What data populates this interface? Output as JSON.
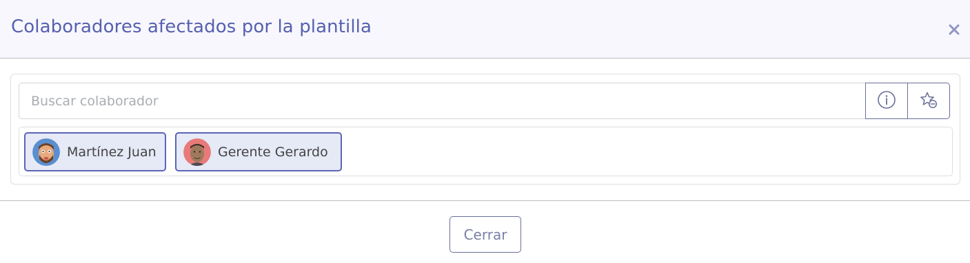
{
  "modal": {
    "title": "Colaboradores afectados por la plantilla",
    "close_icon": "close-icon"
  },
  "search": {
    "placeholder": "Buscar colaborador",
    "value": "",
    "info_icon": "info-icon",
    "favorite_icon": "star-minus-icon"
  },
  "collaborators": [
    {
      "name": "Martínez Juan",
      "avatar": "cartoon-avatar"
    },
    {
      "name": "Gerente Gerardo",
      "avatar": "photo-avatar"
    }
  ],
  "footer": {
    "close_label": "Cerrar"
  },
  "colors": {
    "accent": "#5a64b8",
    "title": "#5660b0",
    "chip_bg": "#e6e9f6",
    "header_bg": "#f7f7fd"
  }
}
